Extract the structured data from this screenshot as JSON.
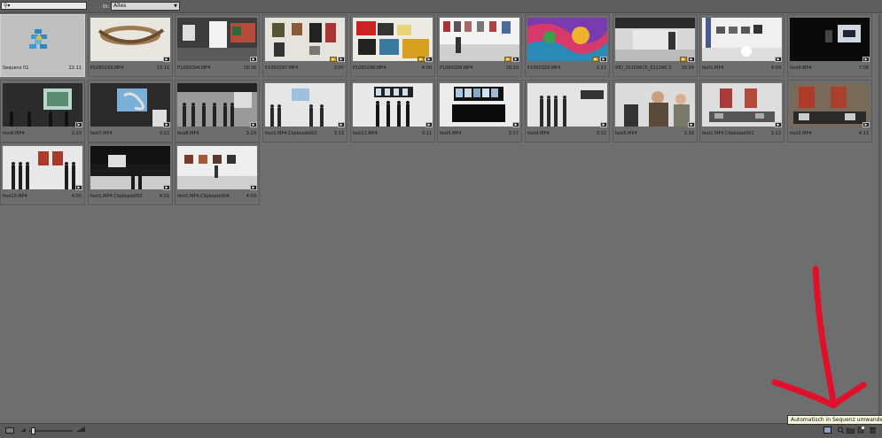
{
  "toolbar": {
    "search_value": "",
    "search_icon": "magnifier-dropdown-icon",
    "in_label": "In:",
    "filter_value": "Alles"
  },
  "clips": [
    {
      "name": "Sequenz 01",
      "duration": "22:11",
      "thumb": "sequence",
      "selected": true,
      "badges": []
    },
    {
      "name": "P1050293.MP4",
      "duration": "13:11",
      "thumb": "sculpture",
      "badges": [
        "dark"
      ]
    },
    {
      "name": "P1050294.MP4",
      "duration": "18:18",
      "thumb": "studio",
      "badges": [
        "dark"
      ]
    },
    {
      "name": "P1050297.MP4",
      "duration": "3:07",
      "thumb": "paintings-wall",
      "badges": [
        "orange",
        "dark"
      ]
    },
    {
      "name": "P1050298.MP4",
      "duration": "4:00",
      "thumb": "collage",
      "badges": [
        "orange",
        "dark"
      ]
    },
    {
      "name": "P1050299.MP4",
      "duration": "18:10",
      "thumb": "gallery-bright",
      "badges": [
        "orange",
        "dark"
      ]
    },
    {
      "name": "P1050328.MP4",
      "duration": "1:11",
      "thumb": "colorful",
      "badges": [
        "orange",
        "dark"
      ]
    },
    {
      "name": "VID_20150615_021246.3...",
      "duration": "15:54",
      "thumb": "ceiling",
      "badges": [
        "orange",
        "dark"
      ]
    },
    {
      "name": "fest1.MP4",
      "duration": "4:09",
      "thumb": "gallery-wide",
      "badges": [
        "dark"
      ]
    },
    {
      "name": "fest9.MP4",
      "duration": "7:08",
      "thumb": "dark-window",
      "badges": [
        "dark"
      ]
    },
    {
      "name": "fest6.MP4",
      "duration": "2:15",
      "thumb": "projection-people",
      "badges": [
        "dark"
      ]
    },
    {
      "name": "fest7.MP4",
      "duration": "3:22",
      "thumb": "projection",
      "badges": [
        "dark"
      ]
    },
    {
      "name": "fest8.MP4",
      "duration": "3:24",
      "thumb": "crowd-hall",
      "badges": [
        "dark"
      ]
    },
    {
      "name": "fest1.MP4.Clipkopie002",
      "duration": "3:13",
      "thumb": "hall-people",
      "badges": [
        "dark"
      ]
    },
    {
      "name": "fest11.MP4",
      "duration": "3:11",
      "thumb": "monitors-people",
      "badges": [
        "dark"
      ]
    },
    {
      "name": "fest3.MP4",
      "duration": "3:17",
      "thumb": "monitors",
      "badges": [
        "dark"
      ]
    },
    {
      "name": "fest4.MP4",
      "duration": "3:32",
      "thumb": "people-standing",
      "badges": [
        "dark"
      ]
    },
    {
      "name": "fest5.MP4",
      "duration": "1:16",
      "thumb": "people-close",
      "badges": [
        "dark"
      ]
    },
    {
      "name": "fest1.MP4.Clipkopie001",
      "duration": "3:12",
      "thumb": "installation",
      "badges": [
        "dark"
      ]
    },
    {
      "name": "fest2.MP4",
      "duration": "4:13",
      "thumb": "red-paintings",
      "badges": [
        "dark"
      ]
    },
    {
      "name": "fest10.MP4",
      "duration": "4:05",
      "thumb": "crowd-red",
      "badges": [
        "dark"
      ]
    },
    {
      "name": "fest1.MP4.Clipkopie003",
      "duration": "4:01",
      "thumb": "dark-room",
      "badges": [
        "dark"
      ]
    },
    {
      "name": "fest1.MP4.Clipkopie004",
      "duration": "4:09",
      "thumb": "gallery-light",
      "badges": [
        "dark"
      ]
    }
  ],
  "bottombar": {
    "zoom_level": 0.05,
    "tooltip": "Automatisch in Sequenz umwandeln..."
  },
  "colors": {
    "panel_bg": "#6e6e6e",
    "selected_bg": "#c0c0c0",
    "annotation_red": "#e0102a"
  }
}
